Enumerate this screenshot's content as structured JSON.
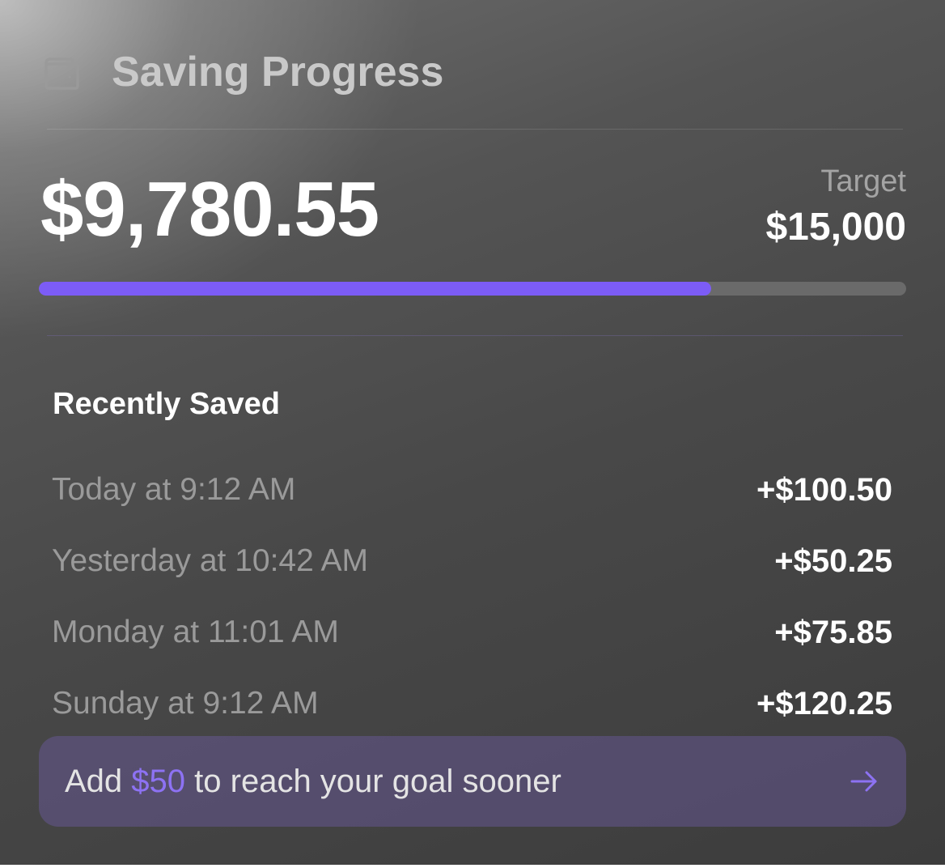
{
  "header": {
    "title": "Saving Progress",
    "icon": "wallet-icon"
  },
  "summary": {
    "saved_amount": "$9,780.55",
    "target_label": "Target",
    "target_value": "$15,000",
    "progress_fraction": 0.775
  },
  "recent": {
    "title": "Recently Saved",
    "items": [
      {
        "time": "Today at 9:12 AM",
        "amount": "+$100.50"
      },
      {
        "time": "Yesterday at 10:42 AM",
        "amount": "+$50.25"
      },
      {
        "time": "Monday at 11:01 AM",
        "amount": "+$75.85"
      },
      {
        "time": "Sunday at 9:12 AM",
        "amount": "+$120.25"
      }
    ]
  },
  "cta": {
    "prefix": "Add ",
    "highlight": "$50",
    "suffix": " to reach your goal sooner",
    "icon": "arrow-right-icon"
  },
  "colors": {
    "accent": "#7c5cf6",
    "highlight_text": "#8d72f3",
    "track": "#6a6a6a"
  }
}
